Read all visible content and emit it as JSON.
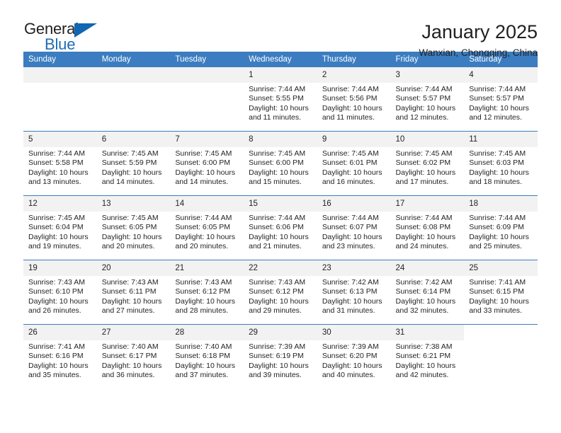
{
  "brand": {
    "name_top": "General",
    "name_bottom": "Blue",
    "accent_color": "#1167b1"
  },
  "header": {
    "title": "January 2025",
    "subtitle": "Wanxian, Chongqing, China"
  },
  "theme": {
    "header_row_bg": "#3b7dc0",
    "day_band_bg": "#f2f2f2",
    "text_color": "#231f20"
  },
  "calendar": {
    "weekday_headers": [
      "Sunday",
      "Monday",
      "Tuesday",
      "Wednesday",
      "Thursday",
      "Friday",
      "Saturday"
    ],
    "weeks": [
      [
        {
          "day": "",
          "empty": true,
          "blank": false,
          "sunrise": "",
          "sunset": "",
          "daylight": ""
        },
        {
          "day": "",
          "empty": true,
          "blank": false,
          "sunrise": "",
          "sunset": "",
          "daylight": ""
        },
        {
          "day": "",
          "empty": true,
          "blank": false,
          "sunrise": "",
          "sunset": "",
          "daylight": ""
        },
        {
          "day": "1",
          "empty": false,
          "blank": false,
          "sunrise": "Sunrise: 7:44 AM",
          "sunset": "Sunset: 5:55 PM",
          "daylight": "Daylight: 10 hours and 11 minutes."
        },
        {
          "day": "2",
          "empty": false,
          "blank": false,
          "sunrise": "Sunrise: 7:44 AM",
          "sunset": "Sunset: 5:56 PM",
          "daylight": "Daylight: 10 hours and 11 minutes."
        },
        {
          "day": "3",
          "empty": false,
          "blank": false,
          "sunrise": "Sunrise: 7:44 AM",
          "sunset": "Sunset: 5:57 PM",
          "daylight": "Daylight: 10 hours and 12 minutes."
        },
        {
          "day": "4",
          "empty": false,
          "blank": false,
          "sunrise": "Sunrise: 7:44 AM",
          "sunset": "Sunset: 5:57 PM",
          "daylight": "Daylight: 10 hours and 12 minutes."
        }
      ],
      [
        {
          "day": "5",
          "empty": false,
          "blank": false,
          "sunrise": "Sunrise: 7:44 AM",
          "sunset": "Sunset: 5:58 PM",
          "daylight": "Daylight: 10 hours and 13 minutes."
        },
        {
          "day": "6",
          "empty": false,
          "blank": false,
          "sunrise": "Sunrise: 7:45 AM",
          "sunset": "Sunset: 5:59 PM",
          "daylight": "Daylight: 10 hours and 14 minutes."
        },
        {
          "day": "7",
          "empty": false,
          "blank": false,
          "sunrise": "Sunrise: 7:45 AM",
          "sunset": "Sunset: 6:00 PM",
          "daylight": "Daylight: 10 hours and 14 minutes."
        },
        {
          "day": "8",
          "empty": false,
          "blank": false,
          "sunrise": "Sunrise: 7:45 AM",
          "sunset": "Sunset: 6:00 PM",
          "daylight": "Daylight: 10 hours and 15 minutes."
        },
        {
          "day": "9",
          "empty": false,
          "blank": false,
          "sunrise": "Sunrise: 7:45 AM",
          "sunset": "Sunset: 6:01 PM",
          "daylight": "Daylight: 10 hours and 16 minutes."
        },
        {
          "day": "10",
          "empty": false,
          "blank": false,
          "sunrise": "Sunrise: 7:45 AM",
          "sunset": "Sunset: 6:02 PM",
          "daylight": "Daylight: 10 hours and 17 minutes."
        },
        {
          "day": "11",
          "empty": false,
          "blank": false,
          "sunrise": "Sunrise: 7:45 AM",
          "sunset": "Sunset: 6:03 PM",
          "daylight": "Daylight: 10 hours and 18 minutes."
        }
      ],
      [
        {
          "day": "12",
          "empty": false,
          "blank": false,
          "sunrise": "Sunrise: 7:45 AM",
          "sunset": "Sunset: 6:04 PM",
          "daylight": "Daylight: 10 hours and 19 minutes."
        },
        {
          "day": "13",
          "empty": false,
          "blank": false,
          "sunrise": "Sunrise: 7:45 AM",
          "sunset": "Sunset: 6:05 PM",
          "daylight": "Daylight: 10 hours and 20 minutes."
        },
        {
          "day": "14",
          "empty": false,
          "blank": false,
          "sunrise": "Sunrise: 7:44 AM",
          "sunset": "Sunset: 6:05 PM",
          "daylight": "Daylight: 10 hours and 20 minutes."
        },
        {
          "day": "15",
          "empty": false,
          "blank": false,
          "sunrise": "Sunrise: 7:44 AM",
          "sunset": "Sunset: 6:06 PM",
          "daylight": "Daylight: 10 hours and 21 minutes."
        },
        {
          "day": "16",
          "empty": false,
          "blank": false,
          "sunrise": "Sunrise: 7:44 AM",
          "sunset": "Sunset: 6:07 PM",
          "daylight": "Daylight: 10 hours and 23 minutes."
        },
        {
          "day": "17",
          "empty": false,
          "blank": false,
          "sunrise": "Sunrise: 7:44 AM",
          "sunset": "Sunset: 6:08 PM",
          "daylight": "Daylight: 10 hours and 24 minutes."
        },
        {
          "day": "18",
          "empty": false,
          "blank": false,
          "sunrise": "Sunrise: 7:44 AM",
          "sunset": "Sunset: 6:09 PM",
          "daylight": "Daylight: 10 hours and 25 minutes."
        }
      ],
      [
        {
          "day": "19",
          "empty": false,
          "blank": false,
          "sunrise": "Sunrise: 7:43 AM",
          "sunset": "Sunset: 6:10 PM",
          "daylight": "Daylight: 10 hours and 26 minutes."
        },
        {
          "day": "20",
          "empty": false,
          "blank": false,
          "sunrise": "Sunrise: 7:43 AM",
          "sunset": "Sunset: 6:11 PM",
          "daylight": "Daylight: 10 hours and 27 minutes."
        },
        {
          "day": "21",
          "empty": false,
          "blank": false,
          "sunrise": "Sunrise: 7:43 AM",
          "sunset": "Sunset: 6:12 PM",
          "daylight": "Daylight: 10 hours and 28 minutes."
        },
        {
          "day": "22",
          "empty": false,
          "blank": false,
          "sunrise": "Sunrise: 7:43 AM",
          "sunset": "Sunset: 6:12 PM",
          "daylight": "Daylight: 10 hours and 29 minutes."
        },
        {
          "day": "23",
          "empty": false,
          "blank": false,
          "sunrise": "Sunrise: 7:42 AM",
          "sunset": "Sunset: 6:13 PM",
          "daylight": "Daylight: 10 hours and 31 minutes."
        },
        {
          "day": "24",
          "empty": false,
          "blank": false,
          "sunrise": "Sunrise: 7:42 AM",
          "sunset": "Sunset: 6:14 PM",
          "daylight": "Daylight: 10 hours and 32 minutes."
        },
        {
          "day": "25",
          "empty": false,
          "blank": false,
          "sunrise": "Sunrise: 7:41 AM",
          "sunset": "Sunset: 6:15 PM",
          "daylight": "Daylight: 10 hours and 33 minutes."
        }
      ],
      [
        {
          "day": "26",
          "empty": false,
          "blank": false,
          "sunrise": "Sunrise: 7:41 AM",
          "sunset": "Sunset: 6:16 PM",
          "daylight": "Daylight: 10 hours and 35 minutes."
        },
        {
          "day": "27",
          "empty": false,
          "blank": false,
          "sunrise": "Sunrise: 7:40 AM",
          "sunset": "Sunset: 6:17 PM",
          "daylight": "Daylight: 10 hours and 36 minutes."
        },
        {
          "day": "28",
          "empty": false,
          "blank": false,
          "sunrise": "Sunrise: 7:40 AM",
          "sunset": "Sunset: 6:18 PM",
          "daylight": "Daylight: 10 hours and 37 minutes."
        },
        {
          "day": "29",
          "empty": false,
          "blank": false,
          "sunrise": "Sunrise: 7:39 AM",
          "sunset": "Sunset: 6:19 PM",
          "daylight": "Daylight: 10 hours and 39 minutes."
        },
        {
          "day": "30",
          "empty": false,
          "blank": false,
          "sunrise": "Sunrise: 7:39 AM",
          "sunset": "Sunset: 6:20 PM",
          "daylight": "Daylight: 10 hours and 40 minutes."
        },
        {
          "day": "31",
          "empty": false,
          "blank": false,
          "sunrise": "Sunrise: 7:38 AM",
          "sunset": "Sunset: 6:21 PM",
          "daylight": "Daylight: 10 hours and 42 minutes."
        },
        {
          "day": "",
          "empty": true,
          "blank": true,
          "sunrise": "",
          "sunset": "",
          "daylight": ""
        }
      ]
    ]
  }
}
